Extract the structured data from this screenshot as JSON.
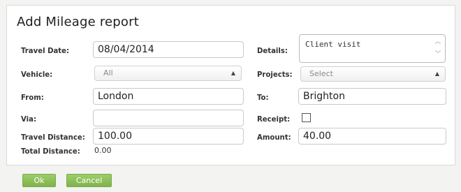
{
  "form": {
    "title": "Add Mileage report",
    "labels": {
      "travel_date": "Travel Date:",
      "vehicle": "Vehicle:",
      "from": "From:",
      "via": "Via:",
      "travel_distance": "Travel Distance:",
      "total_distance": "Total Distance:",
      "details": "Details:",
      "projects": "Projects:",
      "to": "To:",
      "receipt": "Receipt:",
      "amount": "Amount:"
    },
    "values": {
      "travel_date": "08/04/2014",
      "vehicle": "All",
      "from": "London",
      "via": "",
      "travel_distance": "100.00",
      "total_distance": "0.00",
      "details": "Client visit",
      "projects": "Select",
      "to": "Brighton",
      "receipt_checked": false,
      "amount": "40.00"
    },
    "buttons": {
      "ok": "Ok",
      "cancel": "Cancel"
    },
    "colors": {
      "button_green": "#8cc05a"
    }
  }
}
